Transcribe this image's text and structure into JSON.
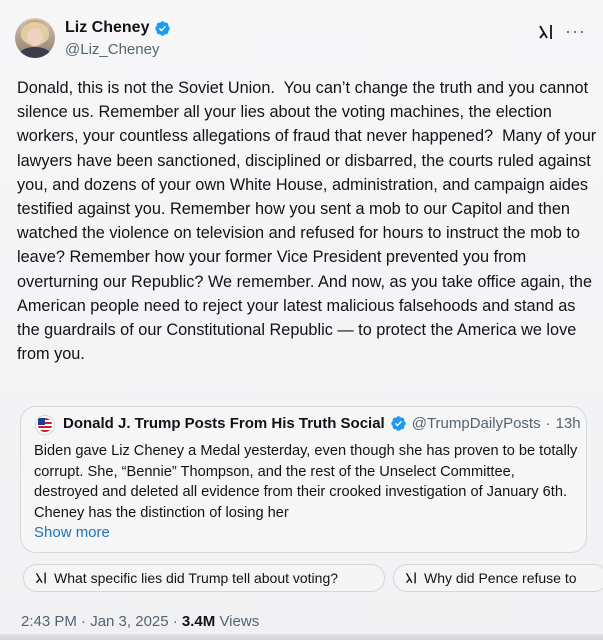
{
  "author": {
    "display_name": "Liz Cheney",
    "handle": "@Liz_Cheney",
    "verified": true
  },
  "icons": {
    "grok": "grok-icon",
    "more": "more-icon",
    "more_glyph": "···",
    "verified": "verified-badge-icon"
  },
  "tweet": {
    "text": "Donald, this is not the Soviet Union.  You can’t change the truth and you cannot silence us. Remember all your lies about the voting machines, the election workers, your countless allegations of fraud that never happened?  Many of your lawyers have been sanctioned, disciplined or disbarred, the courts ruled against you, and dozens of your own White House, administration, and campaign aides testified against you. Remember how you sent a mob to our Capitol and then watched the violence on television and refused for hours to instruct the mob to leave? Remember how your former Vice President prevented you from overturning our Republic? We remember. And now, as you take office again, the American people need to reject your latest malicious falsehoods and stand as the guardrails of our Constitutional Republic — to protect the America we love from you."
  },
  "quote": {
    "display_name": "Donald J. Trump Posts From His Truth Social",
    "handle": "@TrumpDailyPosts",
    "dot": "·",
    "time": "13h",
    "text": "Biden gave Liz Cheney a Medal yesterday, even though she has proven to be totally corrupt. She, “Bennie” Thompson, and the rest of the Unselect Committee, destroyed and deleted all evidence from their crooked investigation of January 6th. Cheney has the distinction of losing her",
    "show_more": "Show more"
  },
  "grok_prompts": [
    {
      "label": "What specific lies did Trump tell about voting?"
    },
    {
      "label": "Why did Pence refuse to"
    }
  ],
  "meta": {
    "timestamp": "2:43 PM · Jan 3, 2025 · ",
    "views_count": "3.4M",
    "views_label": " Views"
  },
  "colors": {
    "verified": "#1d9bf0",
    "link": "#1d74bd",
    "secondary_text": "#536471"
  }
}
